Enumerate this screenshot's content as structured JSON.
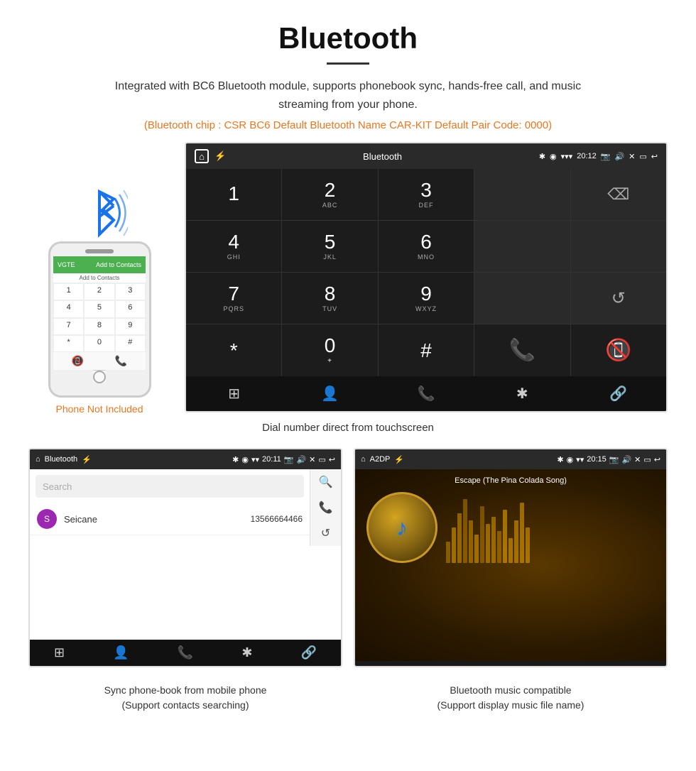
{
  "header": {
    "title": "Bluetooth",
    "description": "Integrated with BC6 Bluetooth module, supports phonebook sync, hands-free call, and music streaming from your phone.",
    "specs": "(Bluetooth chip : CSR BC6    Default Bluetooth Name CAR-KIT    Default Pair Code: 0000)"
  },
  "dial_screen": {
    "status_bar": {
      "label": "Bluetooth",
      "time": "20:12"
    },
    "keys": [
      {
        "main": "1",
        "sub": ""
      },
      {
        "main": "2",
        "sub": "ABC"
      },
      {
        "main": "3",
        "sub": "DEF"
      },
      {
        "main": "",
        "sub": ""
      },
      {
        "main": "⌫",
        "sub": ""
      },
      {
        "main": "4",
        "sub": "GHI"
      },
      {
        "main": "5",
        "sub": "JKL"
      },
      {
        "main": "6",
        "sub": "MNO"
      },
      {
        "main": "",
        "sub": ""
      },
      {
        "main": "",
        "sub": ""
      },
      {
        "main": "7",
        "sub": "PQRS"
      },
      {
        "main": "8",
        "sub": "TUV"
      },
      {
        "main": "9",
        "sub": "WXYZ"
      },
      {
        "main": "",
        "sub": ""
      },
      {
        "main": "↺",
        "sub": ""
      },
      {
        "main": "*",
        "sub": ""
      },
      {
        "main": "0",
        "sub": "+"
      },
      {
        "main": "#",
        "sub": ""
      },
      {
        "main": "📞",
        "sub": ""
      },
      {
        "main": "📵",
        "sub": ""
      }
    ],
    "bottom_icons": [
      "⊞",
      "👤",
      "📞",
      "✱",
      "🔗"
    ]
  },
  "dial_caption": "Dial number direct from touchscreen",
  "phonebook_screen": {
    "status_bar": {
      "label": "Bluetooth",
      "time": "20:11"
    },
    "search_placeholder": "Search",
    "contacts": [
      {
        "initial": "S",
        "name": "Seicane",
        "number": "13566664466"
      }
    ],
    "bottom_icons": [
      "⊞",
      "👤",
      "📞",
      "✱",
      "🔗"
    ]
  },
  "music_screen": {
    "status_bar": {
      "label": "A2DP",
      "time": "20:15"
    },
    "song_title": "Escape (The Pina Colada Song)",
    "eq_bars": [
      30,
      50,
      70,
      90,
      60,
      40,
      80,
      55,
      65,
      45,
      75,
      35,
      60,
      85,
      50
    ]
  },
  "phone_aside": {
    "not_included_text": "Phone Not Included"
  },
  "bottom_captions": {
    "phonebook": "Sync phone-book from mobile phone\n(Support contacts searching)",
    "music": "Bluetooth music compatible\n(Support display music file name)"
  }
}
